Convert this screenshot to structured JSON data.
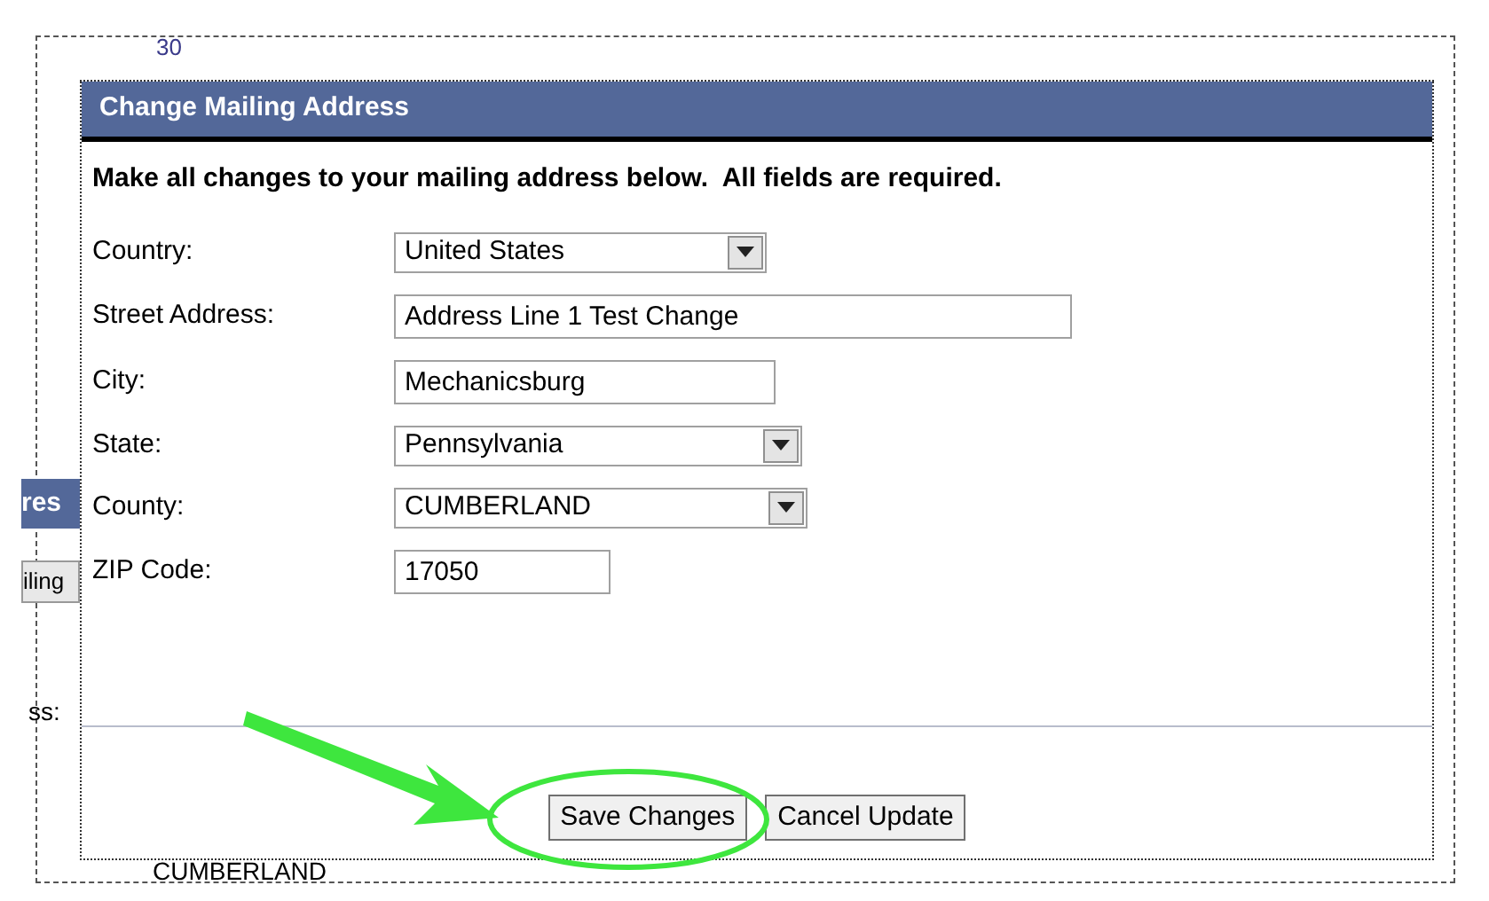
{
  "background_page": {
    "top_text": "30",
    "left_tab": "res",
    "left_button": "iling",
    "left_label": "ss:",
    "bottom_text": "CUMBERLAND"
  },
  "dialog": {
    "title": "Change Mailing Address",
    "instruction": "Make all changes to your mailing address below.  All fields are required.",
    "fields": [
      {
        "label": "Country:",
        "kind": "select",
        "value": "United States"
      },
      {
        "label": "Street Address:",
        "kind": "text",
        "value": "Address Line 1 Test Change"
      },
      {
        "label": "City:",
        "kind": "text",
        "value": "Mechanicsburg"
      },
      {
        "label": "State:",
        "kind": "select",
        "value": "Pennsylvania"
      },
      {
        "label": "County:",
        "kind": "select",
        "value": "CUMBERLAND"
      },
      {
        "label": "ZIP Code:",
        "kind": "text",
        "value": "17050"
      }
    ],
    "buttons": [
      "Save Changes",
      "Cancel Update"
    ]
  }
}
